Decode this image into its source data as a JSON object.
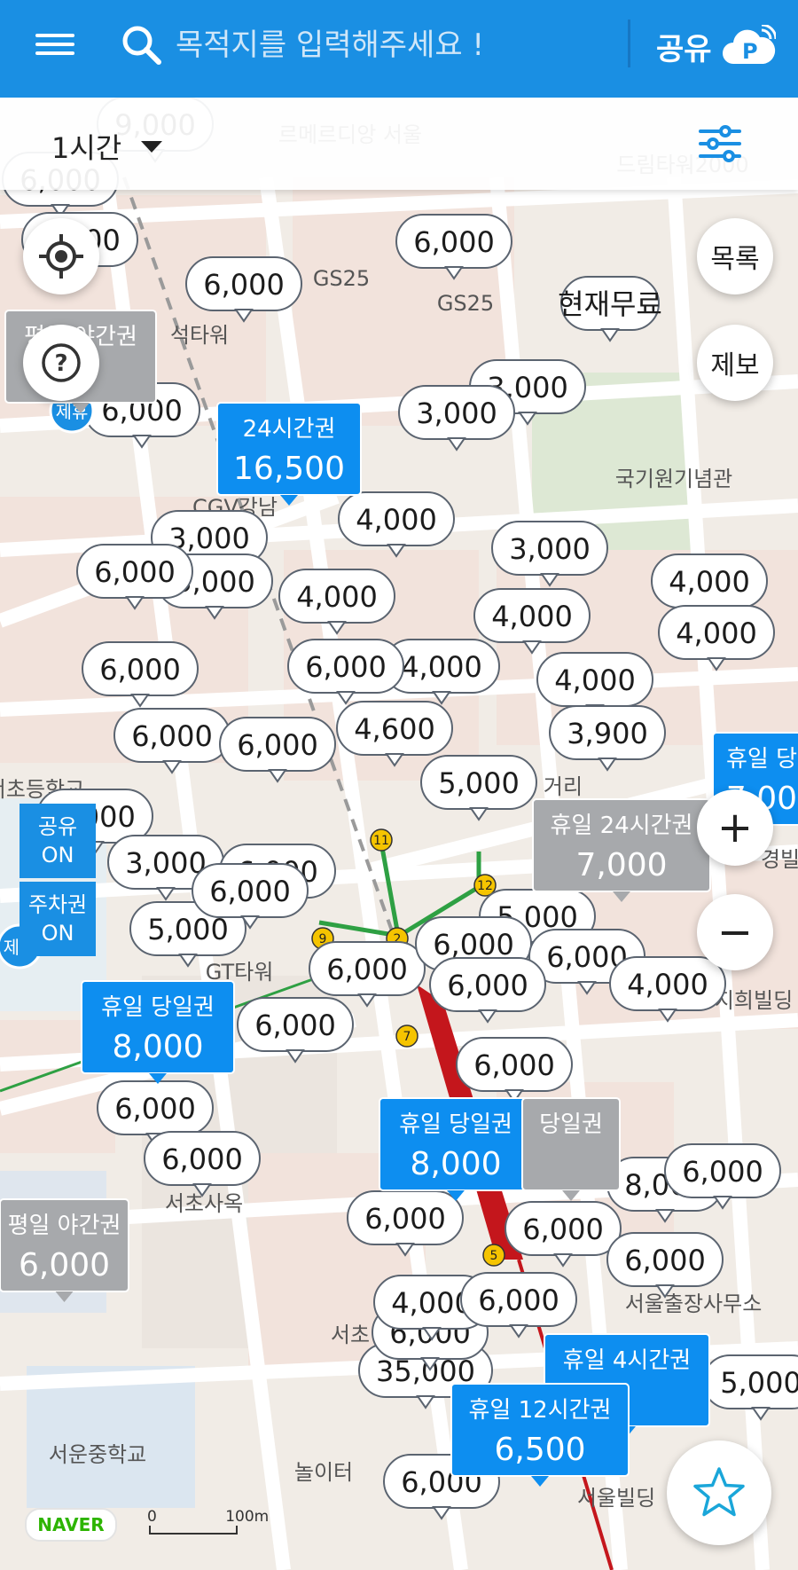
{
  "header": {
    "search_placeholder": "목적지를 입력해주세요 !",
    "share_label": "공유",
    "brand_color": "#1a8fe3"
  },
  "filter": {
    "duration": "1시간"
  },
  "controls": {
    "list_label": "목록",
    "report_label": "제보",
    "zoom_in": "+",
    "zoom_out": "−"
  },
  "toggles": {
    "share": {
      "title": "공유",
      "state": "ON"
    },
    "parking": {
      "title": "주차권",
      "state": "ON"
    }
  },
  "map_places": [
    {
      "name": "르메르디앙 서울"
    },
    {
      "name": "드림타워2000"
    },
    {
      "name": "GS25"
    },
    {
      "name": "GS25"
    },
    {
      "name": "국기원기념관"
    },
    {
      "name": "CGV강남"
    },
    {
      "name": "GT타워"
    },
    {
      "name": "서초사옥"
    },
    {
      "name": "지희빌딩"
    },
    {
      "name": "서울출장사무소"
    },
    {
      "name": "서운중학교"
    },
    {
      "name": "서울빌딩"
    },
    {
      "name": "놀이터"
    },
    {
      "name": "거리"
    },
    {
      "name": "석타워"
    },
    {
      "name": "서초"
    },
    {
      "name": "서초등학교"
    },
    {
      "name": "경빌"
    }
  ],
  "price_bubbles": [
    {
      "price": "6,000"
    },
    {
      "price": "9,000"
    },
    {
      "price": "6,000"
    },
    {
      "price": "6,000"
    },
    {
      "price": "6,000"
    },
    {
      "price": "현재무료"
    },
    {
      "price": "6,000"
    },
    {
      "price": "3,000"
    },
    {
      "price": "3,000"
    },
    {
      "price": "4,000"
    },
    {
      "price": "3,000"
    },
    {
      "price": "3,000"
    },
    {
      "price": "6,000"
    },
    {
      "price": "4,000"
    },
    {
      "price": "3,000"
    },
    {
      "price": "4,000"
    },
    {
      "price": "4,000"
    },
    {
      "price": "4,000"
    },
    {
      "price": "6,000"
    },
    {
      "price": "4,000"
    },
    {
      "price": "4,000"
    },
    {
      "price": "6,000"
    },
    {
      "price": "6,000"
    },
    {
      "price": "6,000"
    },
    {
      "price": "4,600"
    },
    {
      "price": "3,900"
    },
    {
      "price": "5,000"
    },
    {
      "price": "5,000"
    },
    {
      "price": "3,000"
    },
    {
      "price": "6,000"
    },
    {
      "price": "5,000"
    },
    {
      "price": "6,000"
    },
    {
      "price": "6,000"
    },
    {
      "price": "5,000"
    },
    {
      "price": "6,000"
    },
    {
      "price": "6,000"
    },
    {
      "price": "4,000"
    },
    {
      "price": "6,000"
    },
    {
      "price": "6,000"
    },
    {
      "price": "6,000"
    },
    {
      "price": "6,000"
    },
    {
      "price": "6,000"
    },
    {
      "price": "8,000"
    },
    {
      "price": "6,000"
    },
    {
      "price": "6,000"
    },
    {
      "price": "6,000"
    },
    {
      "price": "35,000"
    },
    {
      "price": "6,000"
    },
    {
      "price": "5,000"
    },
    {
      "price": "4,000"
    },
    {
      "price": "6,000"
    },
    {
      "price": "6,000"
    },
    {
      "price": "6,000"
    }
  ],
  "ticket_cards": [
    {
      "title": "24시간권",
      "price": "16,500",
      "kind": "blue"
    },
    {
      "title": "휴일 당일권",
      "price": "8,000",
      "kind": "blue"
    },
    {
      "title": "휴일 당일권",
      "price": "8,000",
      "kind": "blue"
    },
    {
      "title": "휴일 24시간권",
      "price": "7,000",
      "kind": "gray"
    },
    {
      "title": "평일 야간권",
      "price": "6,000",
      "kind": "gray"
    },
    {
      "title": "휴일 4시간권",
      "price": "",
      "kind": "blue"
    },
    {
      "title": "휴일 12시간권",
      "price": "6,500",
      "kind": "blue"
    },
    {
      "title": "휴일 당",
      "price": "7,00",
      "kind": "blue"
    },
    {
      "title": "평일 야간권",
      "price": "",
      "kind": "gray"
    },
    {
      "title": "당일권",
      "price": "",
      "kind": "gray"
    }
  ],
  "badges": {
    "partner": "제휴"
  },
  "subway_numbers": [
    "11",
    "12",
    "9",
    "7",
    "5",
    "2"
  ],
  "footer": {
    "logo": "NAVER",
    "scale_zero": "0",
    "scale_label": "100m"
  }
}
